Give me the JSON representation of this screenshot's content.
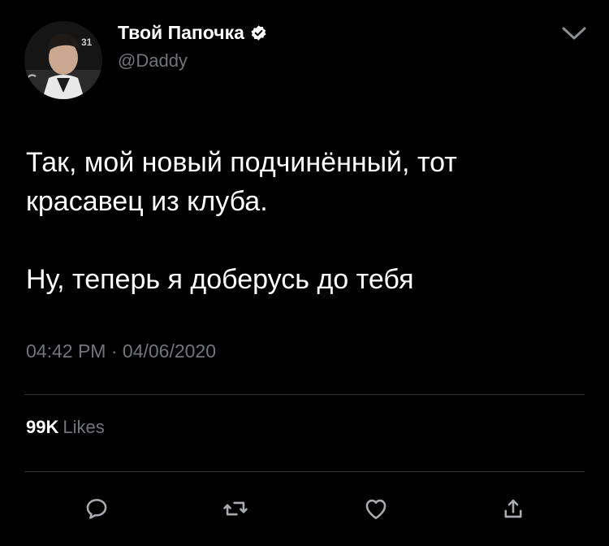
{
  "tweet": {
    "author": {
      "display_name": "Твой Папочка",
      "handle": "@Daddy",
      "verified": true
    },
    "text_lines": [
      "Так, мой новый подчинённый, тот",
      "красавец из клуба.",
      "Ну, теперь я доберусь до тебя"
    ],
    "time": "04:42 PM",
    "date": "04/06/2020",
    "separator": "·",
    "likes_count": "99K",
    "likes_label": "Likes"
  },
  "icons": {
    "reply": "speech-bubble-icon",
    "retweet": "retweet-icon",
    "like": "heart-icon",
    "share": "share-icon",
    "menu": "chevron-down-icon",
    "verified": "verified-badge-icon"
  },
  "colors": {
    "background": "#000000",
    "text_primary": "#ffffff",
    "text_secondary": "#71767b",
    "divider": "#2f3336"
  }
}
